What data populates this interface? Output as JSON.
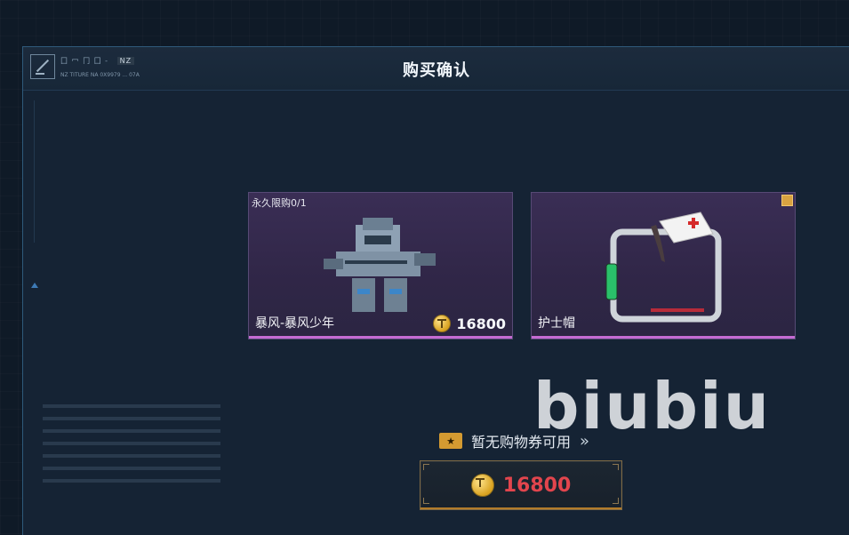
{
  "header": {
    "title": "购买确认",
    "code_text": "囗 冖 冂 囗 -",
    "code_tag": "NZ",
    "subtitle": "NZ TITURE NA 0X9979 ... 07A"
  },
  "cards": [
    {
      "limit": "永久限购0/1",
      "name": "暴风-暴风少年",
      "price": "16800",
      "icon": "mech-icon"
    },
    {
      "limit": "",
      "name": "护士帽",
      "price": "",
      "icon": "nurse-frame-icon"
    }
  ],
  "watermark": "biubiu",
  "coupon": {
    "text": "暂无购物券可用",
    "icon": "coupon-icon",
    "arrow": "chevron-right-icon"
  },
  "purchase": {
    "price": "16800",
    "currency_icon": "coin-icon"
  },
  "colors": {
    "accent": "#c46bd2",
    "price_red": "#e2454d",
    "gold": "#d49a31"
  }
}
